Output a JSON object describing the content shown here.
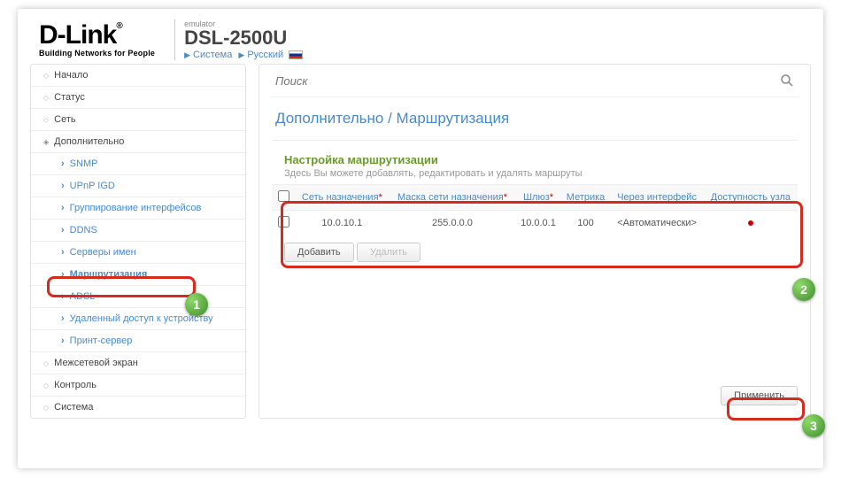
{
  "header": {
    "logo_brand": "D-Link",
    "logo_reg": "®",
    "logo_tagline": "Building Networks for People",
    "emulator_label": "emulator",
    "model": "DSL-2500U",
    "crumb_system": "Система",
    "crumb_lang": "Русский"
  },
  "sidebar": {
    "items": [
      {
        "label": "Начало",
        "type": "top"
      },
      {
        "label": "Статус",
        "type": "top"
      },
      {
        "label": "Сеть",
        "type": "top"
      },
      {
        "label": "Дополнительно",
        "type": "top-open"
      },
      {
        "label": "SNMP",
        "type": "sub"
      },
      {
        "label": "UPnP IGD",
        "type": "sub"
      },
      {
        "label": "Группирование интерфейсов",
        "type": "sub"
      },
      {
        "label": "DDNS",
        "type": "sub"
      },
      {
        "label": "Серверы имен",
        "type": "sub"
      },
      {
        "label": "Маршрутизация",
        "type": "sub-active"
      },
      {
        "label": "ADSL",
        "type": "sub"
      },
      {
        "label": "Удаленный доступ к устройству",
        "type": "sub"
      },
      {
        "label": "Принт-сервер",
        "type": "sub"
      },
      {
        "label": "Межсетевой экран",
        "type": "top"
      },
      {
        "label": "Контроль",
        "type": "top"
      },
      {
        "label": "Система",
        "type": "top"
      }
    ]
  },
  "content": {
    "search_placeholder": "Поиск",
    "page_title": "Дополнительно /  Маршрутизация",
    "section_title": "Настройка маршрутизации",
    "section_desc": "Здесь Вы можете добавлять, редактировать и удалять маршруты",
    "columns": {
      "dest": "Сеть назначения",
      "mask": "Маска сети назначения",
      "gw": "Шлюз",
      "metric": "Метрика",
      "iface": "Через интерфейс",
      "avail": "Доступность узла"
    },
    "row": {
      "dest": "10.0.10.1",
      "mask": "255.0.0.0",
      "gw": "10.0.0.1",
      "metric": "100",
      "iface": "<Автоматически>"
    },
    "btn_add": "Добавить",
    "btn_del": "Удалить",
    "btn_apply": "Применить"
  },
  "badges": {
    "b1": "1",
    "b2": "2",
    "b3": "3"
  }
}
